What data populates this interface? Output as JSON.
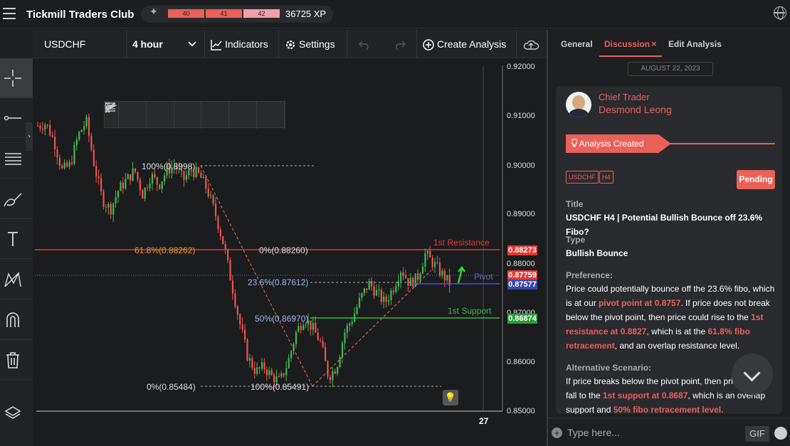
{
  "app": {
    "title": "Tickmill Traders Club"
  },
  "xp": {
    "cells": [
      "40",
      "41",
      "42"
    ],
    "total": "36725 XP"
  },
  "toolbar": {
    "symbol": "USDCHF",
    "timeframe": "4 hour",
    "indicators": "Indicators",
    "settings": "Settings",
    "create": "Create Analysis"
  },
  "chart": {
    "price_ticks": [
      "0.92000",
      "0.91000",
      "0.90000",
      "0.89000",
      "0.88000",
      "0.87000",
      "0.86000",
      "0.85000"
    ],
    "time_tick": "27",
    "fib_labels": {
      "f100a": "100%(0.8998)",
      "f618": "61.8%(0.88262)",
      "f0a": "0%(0.88260)",
      "f236": "23.6%(0.87612)",
      "f50": "50%(0.86970)",
      "f0b": "0%(0.85484)",
      "f100b": "100%(0.85491)"
    },
    "levels": {
      "resistance": "1st Resistance",
      "pivot": "Pivot",
      "support": "1st Support"
    },
    "price_tags": [
      "0.88273",
      "0.87759",
      "0.87577",
      "0.86874"
    ],
    "tag_colors": [
      "#e53935",
      "#e53935",
      "#3949ab",
      "#2e9e3e"
    ]
  },
  "chart_data": {
    "type": "line",
    "ylim": [
      0.85,
      0.92
    ],
    "series": [
      {
        "values": [
          0.908,
          0.9085,
          0.905,
          0.899,
          0.9,
          0.906,
          0.909,
          0.9,
          0.893,
          0.891,
          0.895,
          0.897,
          0.899,
          0.894,
          0.898,
          0.896,
          0.899,
          0.9,
          0.897,
          0.899,
          0.898,
          0.895,
          0.89,
          0.884,
          0.876,
          0.868,
          0.861,
          0.858,
          0.859,
          0.857,
          0.856,
          0.86,
          0.866,
          0.869,
          0.867,
          0.864,
          0.857,
          0.859,
          0.866,
          0.869,
          0.873,
          0.876,
          0.874,
          0.872,
          0.875,
          0.879,
          0.876,
          0.877,
          0.882,
          0.88,
          0.878,
          0.876
        ]
      }
    ]
  },
  "panel": {
    "tabs": {
      "general": "General",
      "discussion": "Discussion",
      "edit": "Edit Analysis",
      "close": "×"
    },
    "date": "AUGUST 22, 2023",
    "author_role": "Chief Trader",
    "author_name": "Desmond Leong",
    "created": "Analysis Created",
    "tags": [
      "USDCHF",
      "H4"
    ],
    "status": "Pending",
    "title_label": "Title",
    "title_value": "USDCHF H4 | Potential Bullish Bounce off 23.6% Fibo?",
    "type_label": "Type",
    "type_value": "Bullish Bounce",
    "pref_label": "Preference:",
    "pref": {
      "t1": "Price could potentially bounce off the 23.6% fibo, which is at our ",
      "h1": "pivot point at 0.8757",
      "t2": ". If price does not break below the pivot point, then price could rise to the ",
      "h2": "1st resistance at 0.8827",
      "t3": ", which is at the ",
      "h3": "61.8% fibo retracement",
      "t4": ", and an overlap resistance level."
    },
    "alt_label": "Alternative Scenario:",
    "alt": {
      "t1": "If price breaks below the pivot point, then price could fall to the ",
      "h1": "1st support at 0.8687",
      "t2": ", which is an overlap support and ",
      "h2": "50% fibo retracement level."
    },
    "chat_placeholder": "Type here...",
    "gif": "GIF"
  }
}
